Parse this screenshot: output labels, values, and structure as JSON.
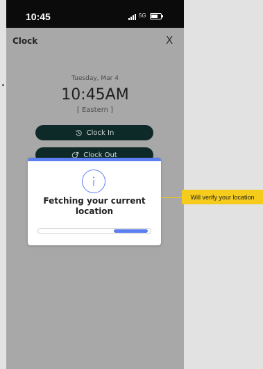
{
  "status_bar": {
    "time": "10:45",
    "network": "5G"
  },
  "header": {
    "title": "Clock",
    "close_glyph": "X"
  },
  "clock": {
    "date": "Tuesday, Mar 4",
    "time": "10:45AM",
    "zone": "[ Eastern ]"
  },
  "buttons": {
    "clock_in": {
      "icon": "clock-in-icon",
      "label": "Clock In"
    },
    "clock_out": {
      "icon": "clock-out-icon",
      "label": "Clock Out"
    }
  },
  "modal": {
    "title": "Fetching your current location",
    "icon": "info-icon",
    "progress": 0.3,
    "accent_color": "#5b7ef0"
  },
  "annotation": {
    "text": "Will verify your location",
    "color": "#f5cc1c"
  }
}
